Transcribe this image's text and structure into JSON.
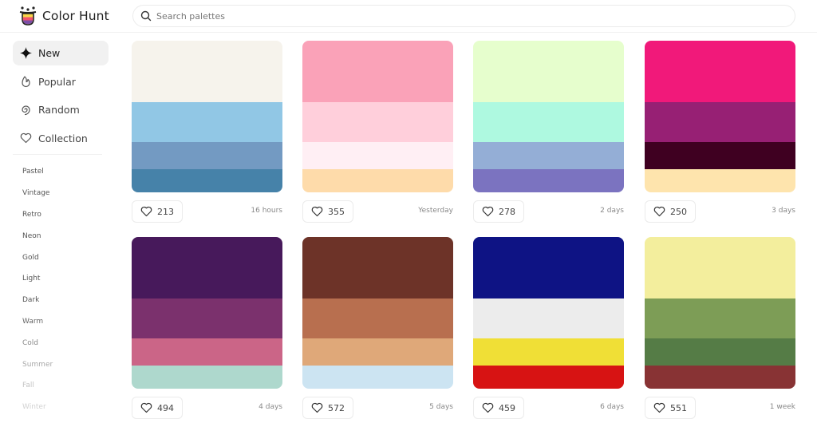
{
  "app": {
    "title": "Color Hunt",
    "logo_colors": [
      "#f9d748",
      "#f2546e",
      "#7b4ea8"
    ]
  },
  "search": {
    "placeholder": "Search palettes",
    "value": ""
  },
  "sidebar": {
    "nav": [
      {
        "label": "New",
        "icon": "sparkle-icon",
        "active": true
      },
      {
        "label": "Popular",
        "icon": "flame-icon",
        "active": false
      },
      {
        "label": "Random",
        "icon": "spiral-icon",
        "active": false
      },
      {
        "label": "Collection",
        "icon": "heart-icon",
        "active": false
      }
    ],
    "tags": [
      {
        "label": "Pastel",
        "color": "#555555"
      },
      {
        "label": "Vintage",
        "color": "#555555"
      },
      {
        "label": "Retro",
        "color": "#555555"
      },
      {
        "label": "Neon",
        "color": "#555555"
      },
      {
        "label": "Gold",
        "color": "#555555"
      },
      {
        "label": "Light",
        "color": "#555555"
      },
      {
        "label": "Dark",
        "color": "#555555"
      },
      {
        "label": "Warm",
        "color": "#666666"
      },
      {
        "label": "Cold",
        "color": "#8a8a8a"
      },
      {
        "label": "Summer",
        "color": "#a8a8a8"
      },
      {
        "label": "Fall",
        "color": "#c4c4c4"
      },
      {
        "label": "Winter",
        "color": "#d2d2d2"
      }
    ]
  },
  "palettes": [
    {
      "colors": [
        "#f6f3ec",
        "#91c7e5",
        "#739ac2",
        "#4682a9"
      ],
      "likes": "213",
      "time": "16 hours"
    },
    {
      "colors": [
        "#faa2b8",
        "#ffcfdb",
        "#ffeff4",
        "#fedbaa"
      ],
      "likes": "355",
      "time": "Yesterday"
    },
    {
      "colors": [
        "#e6fecd",
        "#aef9e0",
        "#94aed6",
        "#7b73c0"
      ],
      "likes": "278",
      "time": "2 days"
    },
    {
      "colors": [
        "#f1197a",
        "#972074",
        "#3f0021",
        "#fee4ad"
      ],
      "likes": "250",
      "time": "3 days"
    },
    {
      "colors": [
        "#47195b",
        "#7b316d",
        "#cb6587",
        "#aed8cd"
      ],
      "likes": "494",
      "time": "4 days"
    },
    {
      "colors": [
        "#6d3328",
        "#b86f4f",
        "#dfa879",
        "#cce4f2"
      ],
      "likes": "572",
      "time": "5 days"
    },
    {
      "colors": [
        "#0e1384",
        "#ececec",
        "#f0df36",
        "#d71313"
      ],
      "likes": "459",
      "time": "6 days"
    },
    {
      "colors": [
        "#f3ee9d",
        "#7d9d56",
        "#557c46",
        "#883334"
      ],
      "likes": "551",
      "time": "1 week"
    }
  ]
}
